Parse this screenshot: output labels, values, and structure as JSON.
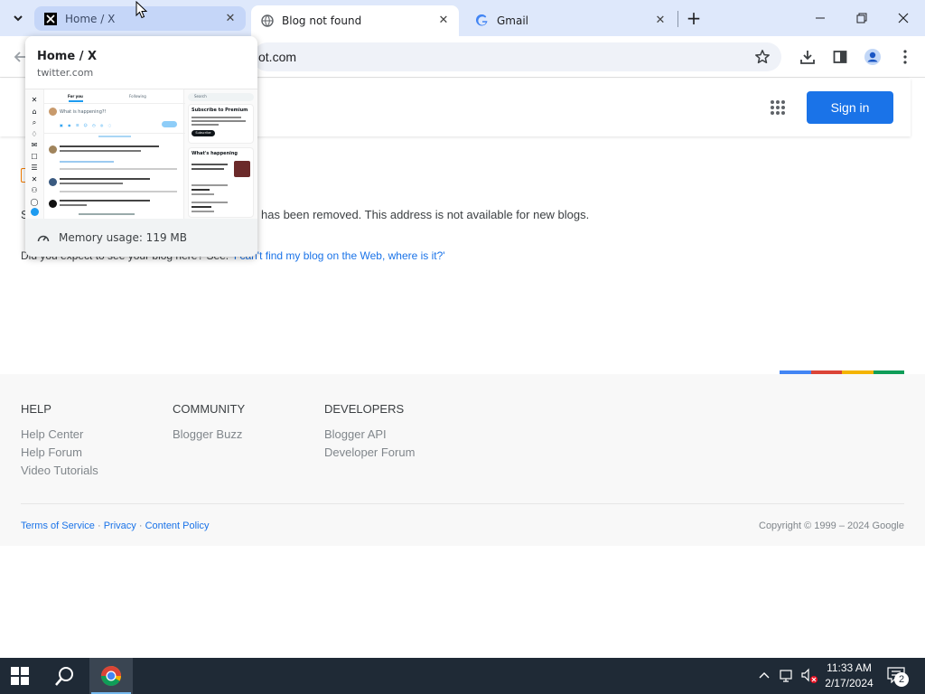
{
  "browser": {
    "tabs": [
      {
        "title": "Home / X",
        "active": false,
        "hovered": true
      },
      {
        "title": "Blog not found",
        "active": true
      },
      {
        "title": "Gmail",
        "active": false
      }
    ],
    "address": "ot.com",
    "hovercard": {
      "title": "Home / X",
      "domain": "twitter.com",
      "memory": "Memory usage: 119 MB",
      "preview": {
        "tabs": [
          "For you",
          "Following"
        ],
        "compose_placeholder": "What is happening?!",
        "search": "Search",
        "premium_title": "Subscribe to Premium",
        "subscribe": "Subscribe",
        "happening_title": "What's happening"
      }
    }
  },
  "blogger": {
    "signin": "Sign in",
    "message_prefix": "S",
    "message_visible": "has been removed. This address is not available for new blogs.",
    "help_prefix": "Did you expect to see your blog here? See: ",
    "help_link": "'I can't find my blog on the Web, where is it?'"
  },
  "footer": {
    "columns": [
      {
        "heading": "HELP",
        "links": [
          "Help Center",
          "Help Forum",
          "Video Tutorials"
        ]
      },
      {
        "heading": "COMMUNITY",
        "links": [
          "Blogger Buzz"
        ]
      },
      {
        "heading": "DEVELOPERS",
        "links": [
          "Blogger API",
          "Developer Forum"
        ]
      }
    ],
    "legal": [
      "Terms of Service",
      "Privacy",
      "Content Policy"
    ],
    "copyright": "Copyright © 1999 – 2024 Google",
    "colors": [
      "#4285f4",
      "#db4437",
      "#f4b400",
      "#0f9d58"
    ]
  },
  "taskbar": {
    "time": "11:33 AM",
    "date": "2/17/2024",
    "notifications": "2"
  },
  "colors": {
    "accent": "#1a73e8",
    "tabstrip": "#dee8fb",
    "taskbar": "#1f2a36"
  }
}
